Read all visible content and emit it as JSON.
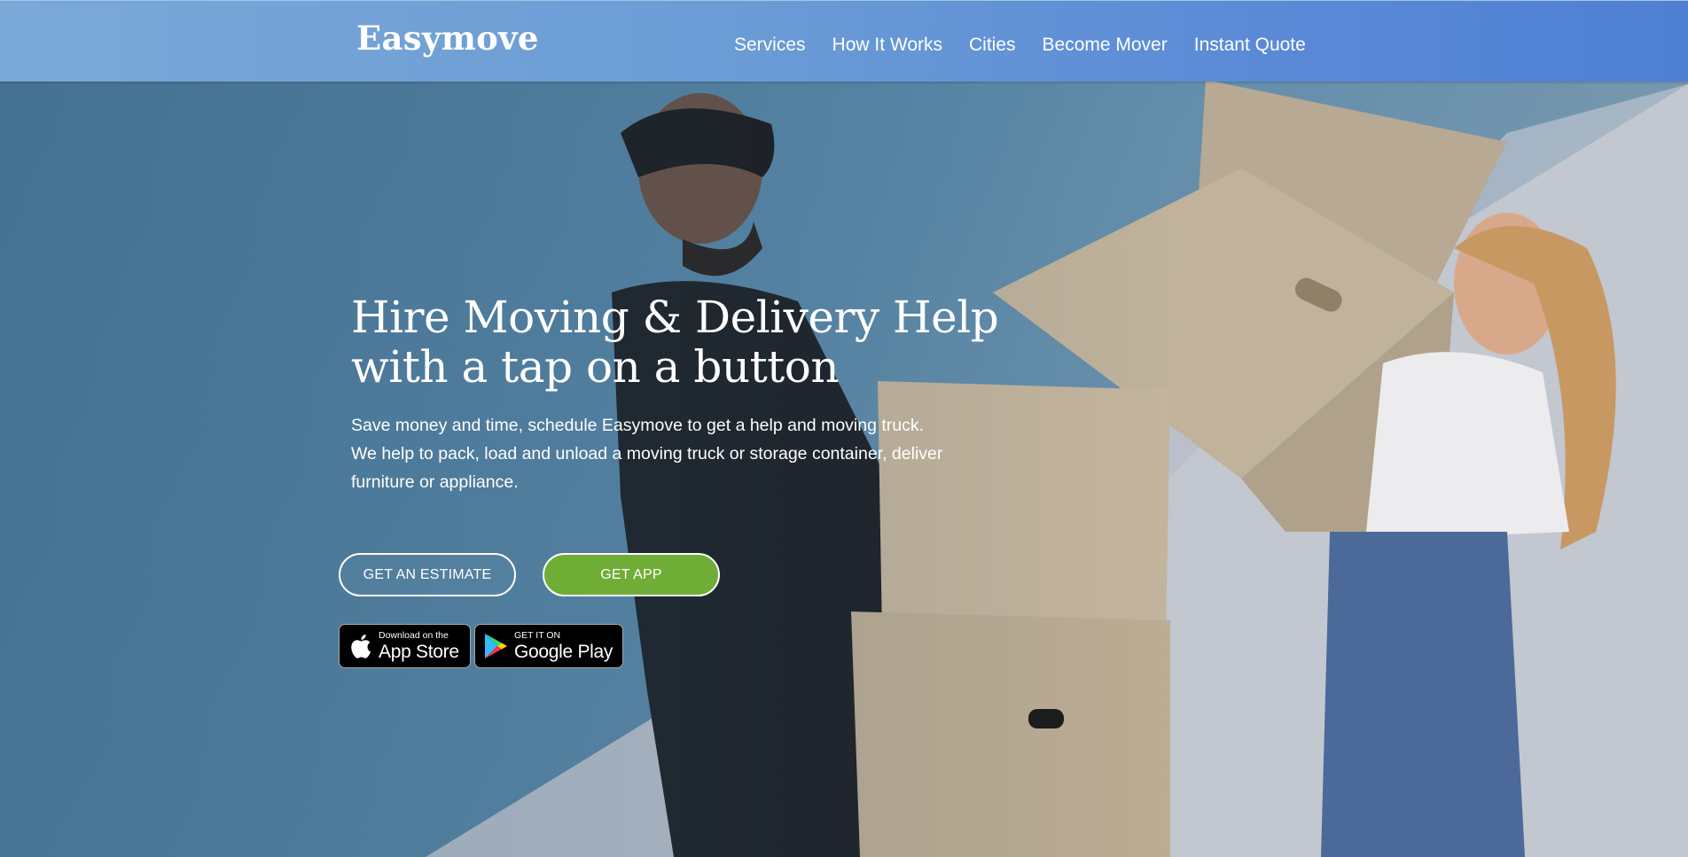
{
  "header": {
    "logo": "Easymove",
    "nav": [
      {
        "label": "Services"
      },
      {
        "label": "How It Works"
      },
      {
        "label": "Cities"
      },
      {
        "label": "Become Mover"
      },
      {
        "label": "Instant Quote"
      }
    ]
  },
  "hero": {
    "title_lines": [
      "Hire Moving & Delivery Help",
      "with a tap on a button"
    ],
    "subtitle_lines": [
      "Save money and time, schedule Easymove to get a help and moving truck.",
      "We help to pack, load and unload a moving truck or storage container, deliver",
      "furniture or appliance."
    ],
    "buttons": {
      "estimate": "GET AN ESTIMATE",
      "get_app": "GET APP"
    },
    "badges": {
      "apple": {
        "small": "Download on the",
        "big": "App Store"
      },
      "google": {
        "small": "GET IT ON",
        "big": "Google Play"
      }
    }
  },
  "colors": {
    "header_gradient_start": "#7aa9d8",
    "header_gradient_end": "#4f80d4",
    "cta_green": "#70ad37",
    "hero_blue": "#4f7c9c"
  },
  "icons": [
    "apple-icon",
    "google-play-icon"
  ]
}
